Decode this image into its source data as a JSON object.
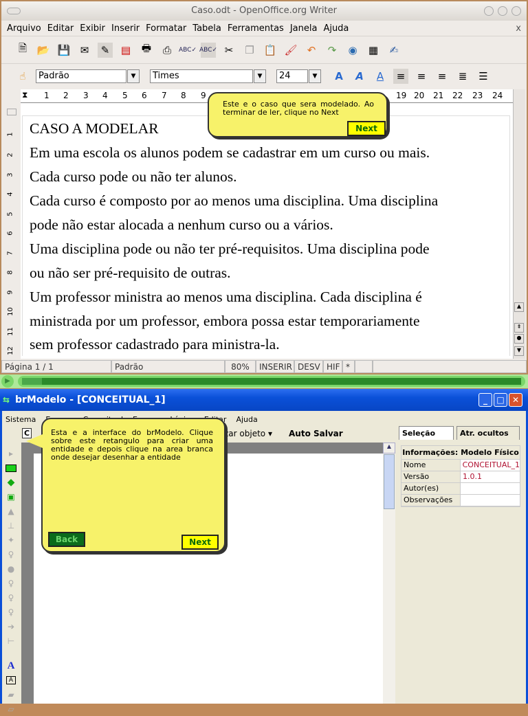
{
  "writer": {
    "title": "Caso.odt - OpenOffice.org Writer",
    "menu": [
      "Arquivo",
      "Editar",
      "Exibir",
      "Inserir",
      "Formatar",
      "Tabela",
      "Ferramentas",
      "Janela",
      "Ajuda"
    ],
    "close": "x",
    "style_value": "Padrão",
    "font_value": "Times",
    "size_value": "24",
    "ruler_ticks": [
      "1",
      "2",
      "3",
      "4",
      "5",
      "6",
      "7",
      "8",
      "9",
      "19",
      "20",
      "21",
      "22",
      "23",
      "24"
    ],
    "vruler_ticks": [
      "1",
      "2",
      "3",
      "4",
      "5",
      "6",
      "7",
      "8",
      "9",
      "10",
      "11",
      "12"
    ],
    "doc_lines": [
      "CASO A MODELAR",
      "Em uma escola os alunos podem se cadastrar em um curso ou mais.",
      "Cada curso pode ou não ter alunos.",
      "Cada curso é composto por ao menos uma disciplina. Uma disciplina",
      "pode não estar alocada a nenhum curso ou a vários.",
      "Uma disciplina pode ou não ter pré-requisitos. Uma disciplina pode",
      "ou não ser pré-requisito de outras.",
      "Um professor ministra ao menos uma disciplina. Cada disciplina é",
      "ministrada por um professor, embora possa estar temporariamente",
      "sem professor cadastrado para ministra-la."
    ],
    "status": {
      "page": "Página 1 / 1",
      "style": "Padrão",
      "zoom": "80%",
      "mode": "INSERIR",
      "sel": "DESV",
      "hyph": "HIF",
      "modified": "*"
    },
    "tooltip": {
      "text": "Este e o caso que sera modelado. Ao terminar de ler, clique no Next",
      "next": "Next"
    }
  },
  "progress": {
    "value": 0.04
  },
  "brmodelo": {
    "title": "brModelo - [CONCEITUAL_1]",
    "menu": [
      "Sistema",
      "Esquema Conceitual",
      "Esquema Lógico",
      "Editar",
      "Ajuda"
    ],
    "toolbar": {
      "c": "C",
      "align": "zar objeto",
      "autosave": "Auto Salvar"
    },
    "tabs": [
      "Seleção",
      "Atr. ocultos"
    ],
    "info_header": "Informações: Modelo Físico",
    "info_rows": [
      {
        "k": "Nome",
        "v": "CONCEITUAL_1"
      },
      {
        "k": "Versão",
        "v": "1.0.1"
      },
      {
        "k": "Autor(es)",
        "v": ""
      },
      {
        "k": "Observações",
        "v": ""
      }
    ],
    "tooltip": {
      "text": "Esta e a interface do brModelo. Clique sobre este retangulo para criar uma entidade e depois clique na area branca onde desejar desenhar a entidade",
      "back": "Back",
      "next": "Next"
    }
  }
}
